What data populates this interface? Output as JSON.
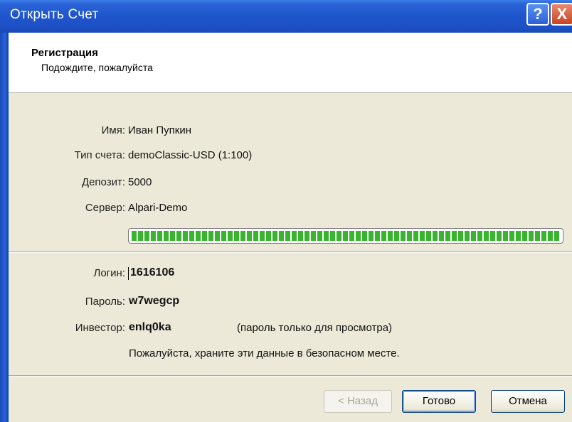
{
  "window": {
    "title": "Открыть Счет",
    "help_glyph": "?",
    "close_glyph": "X"
  },
  "header": {
    "title": "Регистрация",
    "subtitle": "Подождите, пожалуйста"
  },
  "account": {
    "name_label": "Имя:",
    "name_value": "Иван Пупкин",
    "type_label": "Тип счета:",
    "type_value": "demoClassic-USD (1:100)",
    "deposit_label": "Депозит:",
    "deposit_value": "5000",
    "server_label": "Сервер:",
    "server_value": "Alpari-Demo"
  },
  "progress": {
    "fraction": 1.0,
    "color": "#37b52d"
  },
  "credentials": {
    "login_label": "Логин:",
    "login_value": "1616106",
    "password_label": "Пароль:",
    "password_value": "w7wegcp",
    "investor_label": "Инвестор:",
    "investor_value": "enlq0ka",
    "investor_note": "(пароль только для просмотра)",
    "notice": "Пожалуйста, храните эти данные в безопасном месте."
  },
  "buttons": {
    "back": "< Назад",
    "finish": "Готово",
    "cancel": "Отмена"
  }
}
